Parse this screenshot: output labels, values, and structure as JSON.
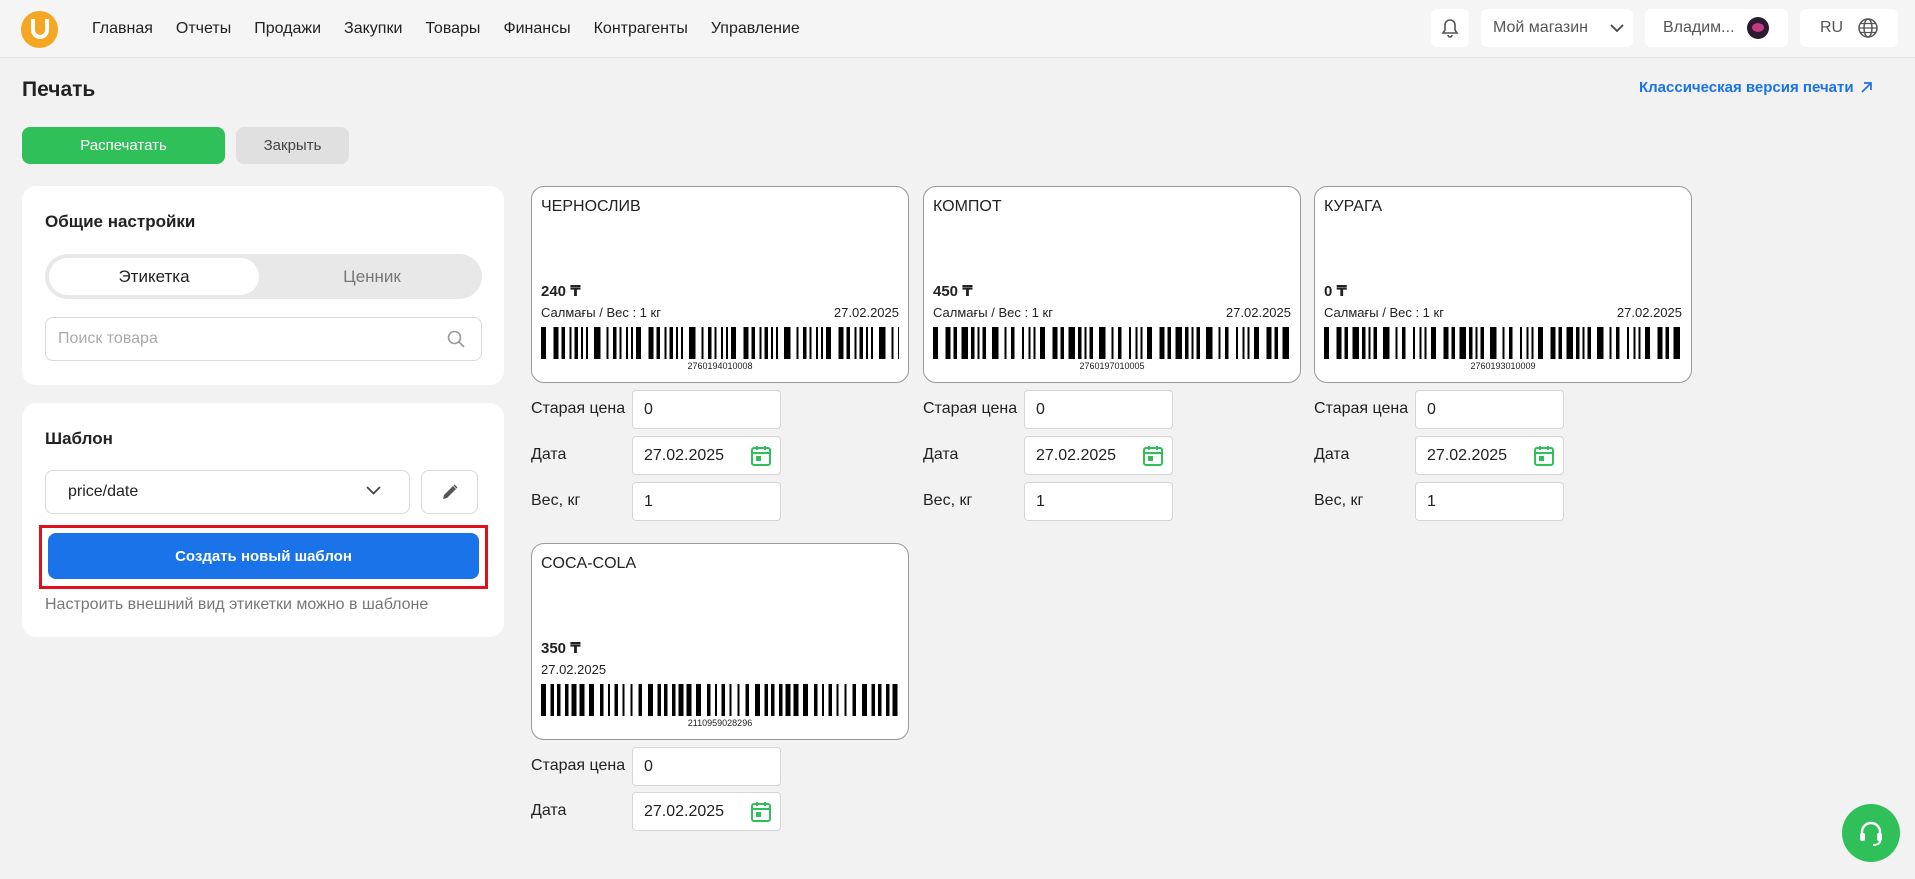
{
  "header": {
    "nav": [
      "Главная",
      "Отчеты",
      "Продажи",
      "Закупки",
      "Товары",
      "Финансы",
      "Контрагенты",
      "Управление"
    ],
    "store": "Мой магазин",
    "user": "Владим...",
    "lang": "RU"
  },
  "page": {
    "title": "Печать",
    "classic_link": "Классическая версия печати",
    "print_button": "Распечатать",
    "close_button": "Закрыть"
  },
  "general": {
    "title": "Общие настройки",
    "tab_label": "Этикетка",
    "tab_price": "Ценник",
    "search_placeholder": "Поиск товара"
  },
  "template": {
    "title": "Шаблон",
    "selected": "price/date",
    "create_button": "Создать новый шаблон",
    "hint": "Настроить внешний вид этикетки можно в шаблоне"
  },
  "fields": {
    "old_price": "Старая цена",
    "date": "Дата",
    "weight": "Вес, кг"
  },
  "cards": [
    {
      "name": "ЧЕРНОСЛИВ",
      "price": "240 ₸",
      "meta": "Салмағы / Вес : 1 кг",
      "date": "27.02.2025",
      "barcode": "2760194010008",
      "old_price": "0",
      "date_value": "27.02.2025",
      "weight": "1"
    },
    {
      "name": "КОМПОТ",
      "price": "450 ₸",
      "meta": "Салмағы / Вес : 1 кг",
      "date": "27.02.2025",
      "barcode": "2760197010005",
      "old_price": "0",
      "date_value": "27.02.2025",
      "weight": "1"
    },
    {
      "name": "КУРАГА",
      "price": "0 ₸",
      "meta": "Салмағы / Вес : 1 кг",
      "date": "27.02.2025",
      "barcode": "2760193010009",
      "old_price": "0",
      "date_value": "27.02.2025",
      "weight": "1"
    },
    {
      "name": "COCA-COLA",
      "price": "350 ₸",
      "date": "27.02.2025",
      "barcode": "2110959028296",
      "old_price": "0",
      "date_value": "27.02.2025"
    }
  ],
  "colors": {
    "primary_green": "#2fc05a",
    "primary_blue": "#1a73e8",
    "highlight_red": "#e0111c",
    "logo": "#f5a623"
  }
}
